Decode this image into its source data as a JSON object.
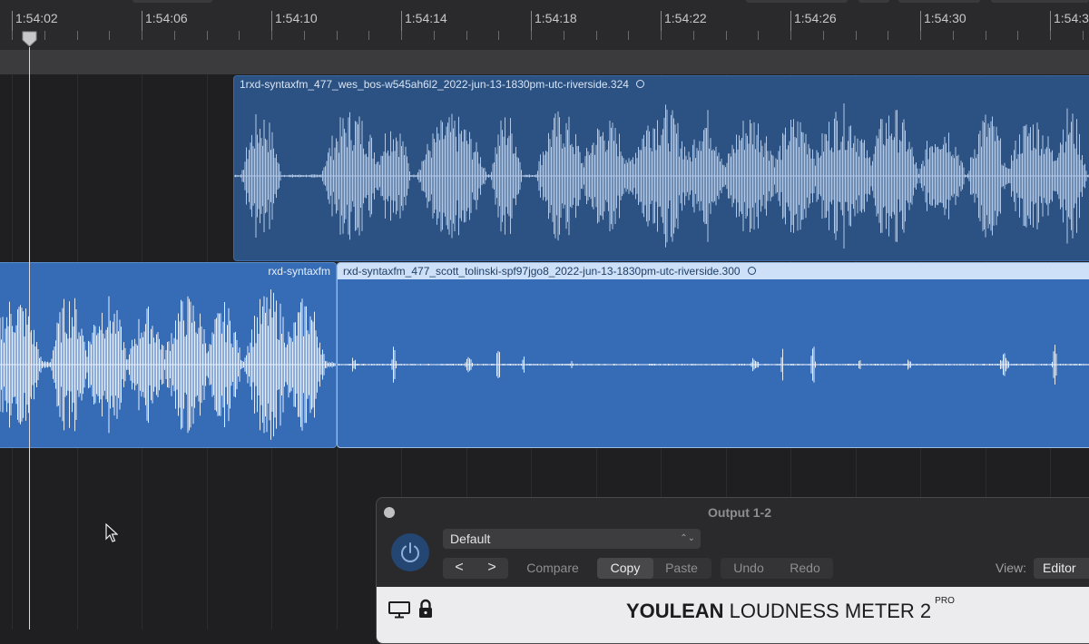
{
  "ruler": {
    "ticks": [
      "1:54:02",
      "1:54:06",
      "1:54:10",
      "1:54:14",
      "1:54:18",
      "1:54:22",
      "1:54:26",
      "1:54:30",
      "1:54:3"
    ],
    "playhead_icon": "playhead-marker-icon"
  },
  "regions": {
    "wes": {
      "title": "1rxd-syntaxfm_477_wes_bos-w545ah6l2_2022-jun-13-1830pm-utc-riverside.324",
      "icon": "loop-icon"
    },
    "left": {
      "title": "rxd-syntaxfm"
    },
    "scott": {
      "title": "rxd-syntaxfm_477_scott_tolinski-spf97jgo8_2022-jun-13-1830pm-utc-riverside.300",
      "icon": "loop-icon"
    }
  },
  "plugin": {
    "title": "Output 1-2",
    "preset": "Default",
    "nav_prev": "<",
    "nav_next": ">",
    "compare": "Compare",
    "copy": "Copy",
    "paste": "Paste",
    "undo": "Undo",
    "redo": "Redo",
    "view_label": "View:",
    "view_value": "Editor",
    "brand_bold": "YOULEAN",
    "brand_rest": " LOUDNESS METER 2",
    "brand_sup": "PRO"
  },
  "colors": {
    "region_dark": "#2c5283",
    "region_selected": "#356cb5",
    "waveform": "#b3c8e6",
    "waveform_bright": "#e6eefb",
    "accent_power": "#244672"
  }
}
